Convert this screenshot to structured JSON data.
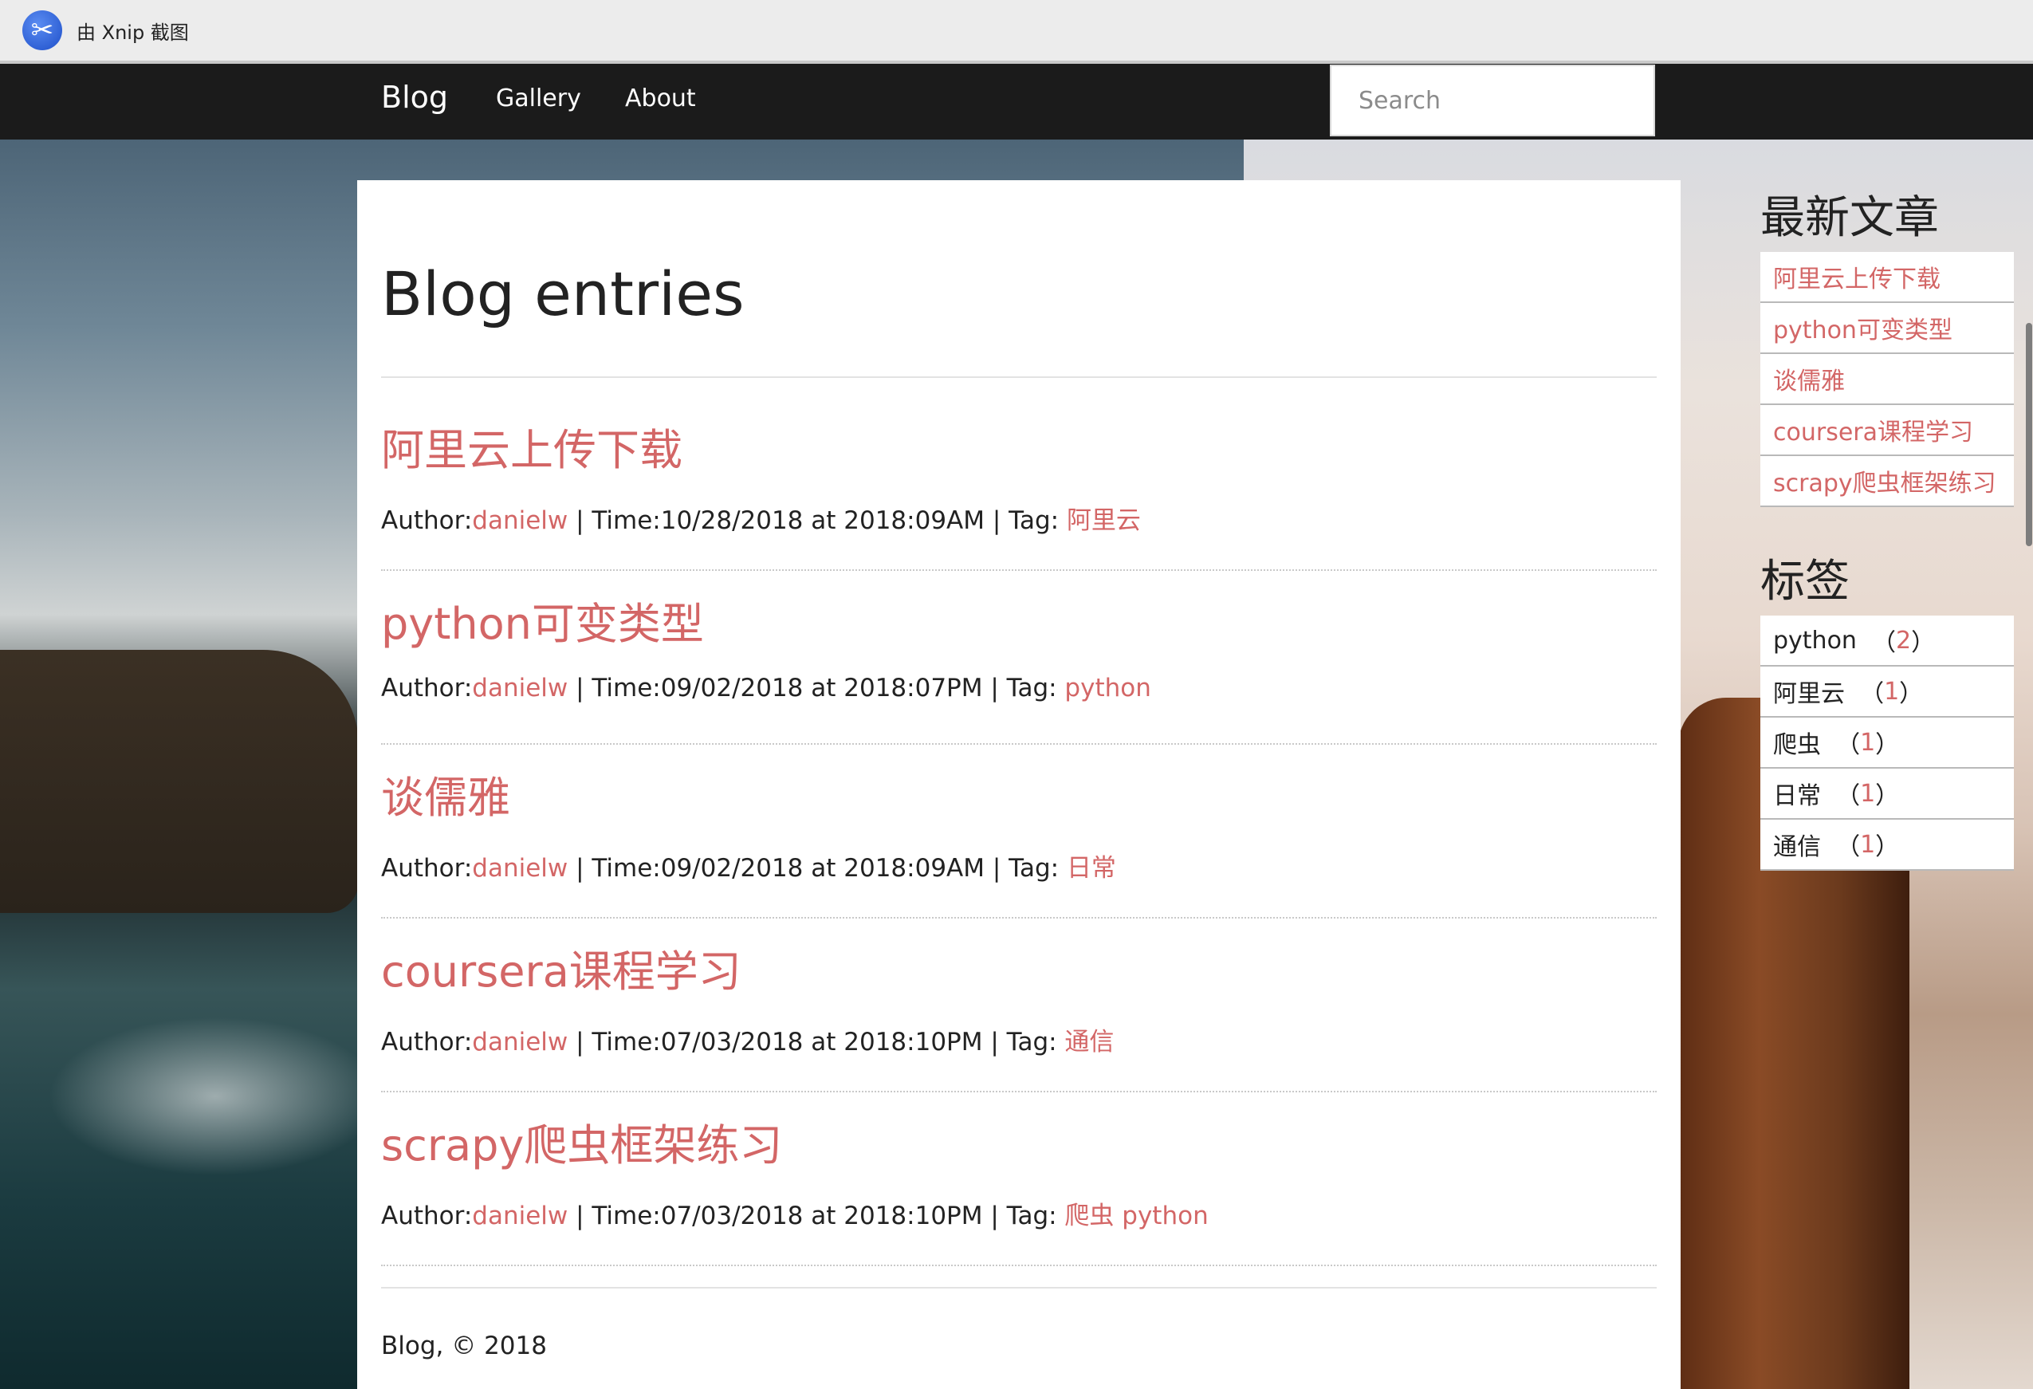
{
  "capture_bar": {
    "title": "由 Xnip 截图"
  },
  "navbar": {
    "brand": "Blog",
    "links": [
      "Gallery",
      "About"
    ],
    "search_placeholder": "Search"
  },
  "main": {
    "heading": "Blog entries",
    "entries": [
      {
        "title": "阿里云上传下载",
        "author_label": "Author:",
        "author": "danielw",
        "time": " | Time:10/28/2018 at 2018:09AM | Tag: ",
        "tags": [
          "阿里云"
        ]
      },
      {
        "title": "python可变类型",
        "author_label": "Author:",
        "author": "danielw",
        "time": " | Time:09/02/2018 at 2018:07PM | Tag: ",
        "tags": [
          "python"
        ]
      },
      {
        "title": "谈儒雅",
        "author_label": "Author:",
        "author": "danielw",
        "time": " | Time:09/02/2018 at 2018:09AM | Tag: ",
        "tags": [
          "日常"
        ]
      },
      {
        "title": "coursera课程学习",
        "author_label": "Author:",
        "author": "danielw",
        "time": " | Time:07/03/2018 at 2018:10PM | Tag: ",
        "tags": [
          "通信"
        ]
      },
      {
        "title": "scrapy爬虫框架练习",
        "author_label": "Author:",
        "author": "danielw",
        "time": " | Time:07/03/2018 at 2018:10PM | Tag: ",
        "tags": [
          "爬虫",
          "python"
        ]
      }
    ],
    "footer": "Blog, © 2018"
  },
  "sidebar": {
    "recent_heading": "最新文章",
    "recent": [
      "阿里云上传下载",
      "python可变类型",
      "谈儒雅",
      "coursera课程学习",
      "scrapy爬虫框架练习"
    ],
    "tags_heading": "标签",
    "tags": [
      {
        "name": "python",
        "count": "2"
      },
      {
        "name": "阿里云",
        "count": "1"
      },
      {
        "name": "爬虫",
        "count": "1"
      },
      {
        "name": "日常",
        "count": "1"
      },
      {
        "name": "通信",
        "count": "1"
      }
    ]
  },
  "colors": {
    "accent": "#d36666",
    "navbar": "#1b1b1b"
  }
}
